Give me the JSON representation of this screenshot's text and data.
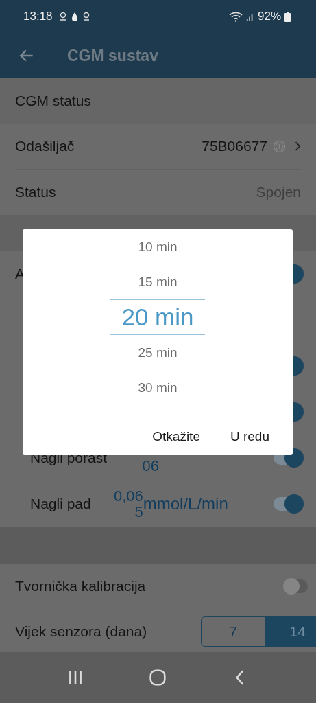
{
  "status_bar": {
    "time": "13:18",
    "battery": "92%"
  },
  "app_bar": {
    "title": "CGM sustav"
  },
  "cgm_section": {
    "header": "CGM status",
    "rows": [
      {
        "label": "Odašiljač",
        "value": "75B06677",
        "kind": "link"
      },
      {
        "label": "Status",
        "value": "Spojen",
        "kind": "plain"
      }
    ]
  },
  "alert_rows": [
    {
      "kind": "toggle",
      "label": "A",
      "on": true
    },
    {
      "kind": "spacer"
    },
    {
      "kind": "toggle",
      "on": true
    },
    {
      "kind": "toggle",
      "on": true
    },
    {
      "kind": "rate",
      "label": "Nagli porast",
      "value_lines": [
        "06"
      ],
      "on": true
    },
    {
      "kind": "rate",
      "label": "Nagli pad",
      "value_lines": [
        "0,06",
        "5"
      ],
      "unit": "mmol/L/min",
      "on": true
    }
  ],
  "sensor_section": {
    "calibration": {
      "label": "Tvornička kalibracija",
      "on": false
    },
    "lifetime": {
      "label": "Vijek senzora (dana)",
      "options": [
        {
          "label": "7",
          "selected": false
        },
        {
          "label": "14",
          "selected": true
        }
      ]
    }
  },
  "picker": {
    "items": [
      {
        "label": "10 min",
        "selected": false
      },
      {
        "label": "15 min",
        "selected": false
      },
      {
        "label": "20 min",
        "selected": true
      },
      {
        "label": "25 min",
        "selected": false
      },
      {
        "label": "30 min",
        "selected": false
      }
    ],
    "buttons": [
      "Otkažite",
      "U redu"
    ]
  }
}
